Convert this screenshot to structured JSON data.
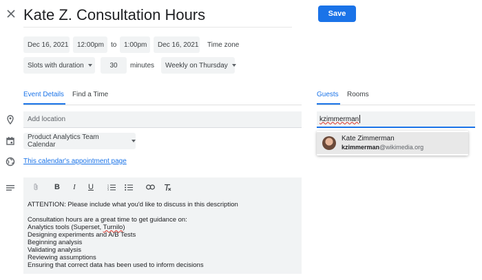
{
  "header": {
    "title": "Kate Z. Consultation Hours",
    "save_label": "Save"
  },
  "datetime": {
    "start_date": "Dec 16, 2021",
    "start_time": "12:00pm",
    "to_label": "to",
    "end_time": "1:00pm",
    "end_date": "Dec 16, 2021",
    "timezone_label": "Time zone"
  },
  "slots": {
    "mode": "Slots with duration",
    "duration": "30",
    "unit_label": "minutes",
    "recurrence": "Weekly on Thursday"
  },
  "tabs": {
    "event_details": "Event Details",
    "find_time": "Find a Time",
    "guests": "Guests",
    "rooms": "Rooms"
  },
  "details": {
    "location_placeholder": "Add location",
    "calendar": "Product Analytics Team Calendar",
    "appointment_link": "This calendar's appointment page"
  },
  "toolbar": {
    "bold": "B",
    "italic": "I",
    "underline": "U"
  },
  "description": {
    "attention": "ATTENTION: Please include what you'd like to discuss in this description",
    "intro": "Consultation hours are a great time to get guidance on:",
    "item1_prefix": "Analytics tools (Superset, ",
    "item1_misspelled": "Turnilo",
    "item1_suffix": ")",
    "item2": "Designing experiments and A/B Tests",
    "item3": "Beginning analysis",
    "item4": "Validating analysis",
    "item5": "Reviewing assumptions",
    "item6": "Ensuring that correct data has been used to inform decisions"
  },
  "guests": {
    "input_value": "kzimmerman",
    "suggestion_name": "Kate Zimmerman",
    "suggestion_email_user": "kzimmerman",
    "suggestion_email_domain": "@wikimedia.org"
  },
  "colors": {
    "accent": "#1a73e8",
    "field_bg": "#f1f3f4"
  }
}
